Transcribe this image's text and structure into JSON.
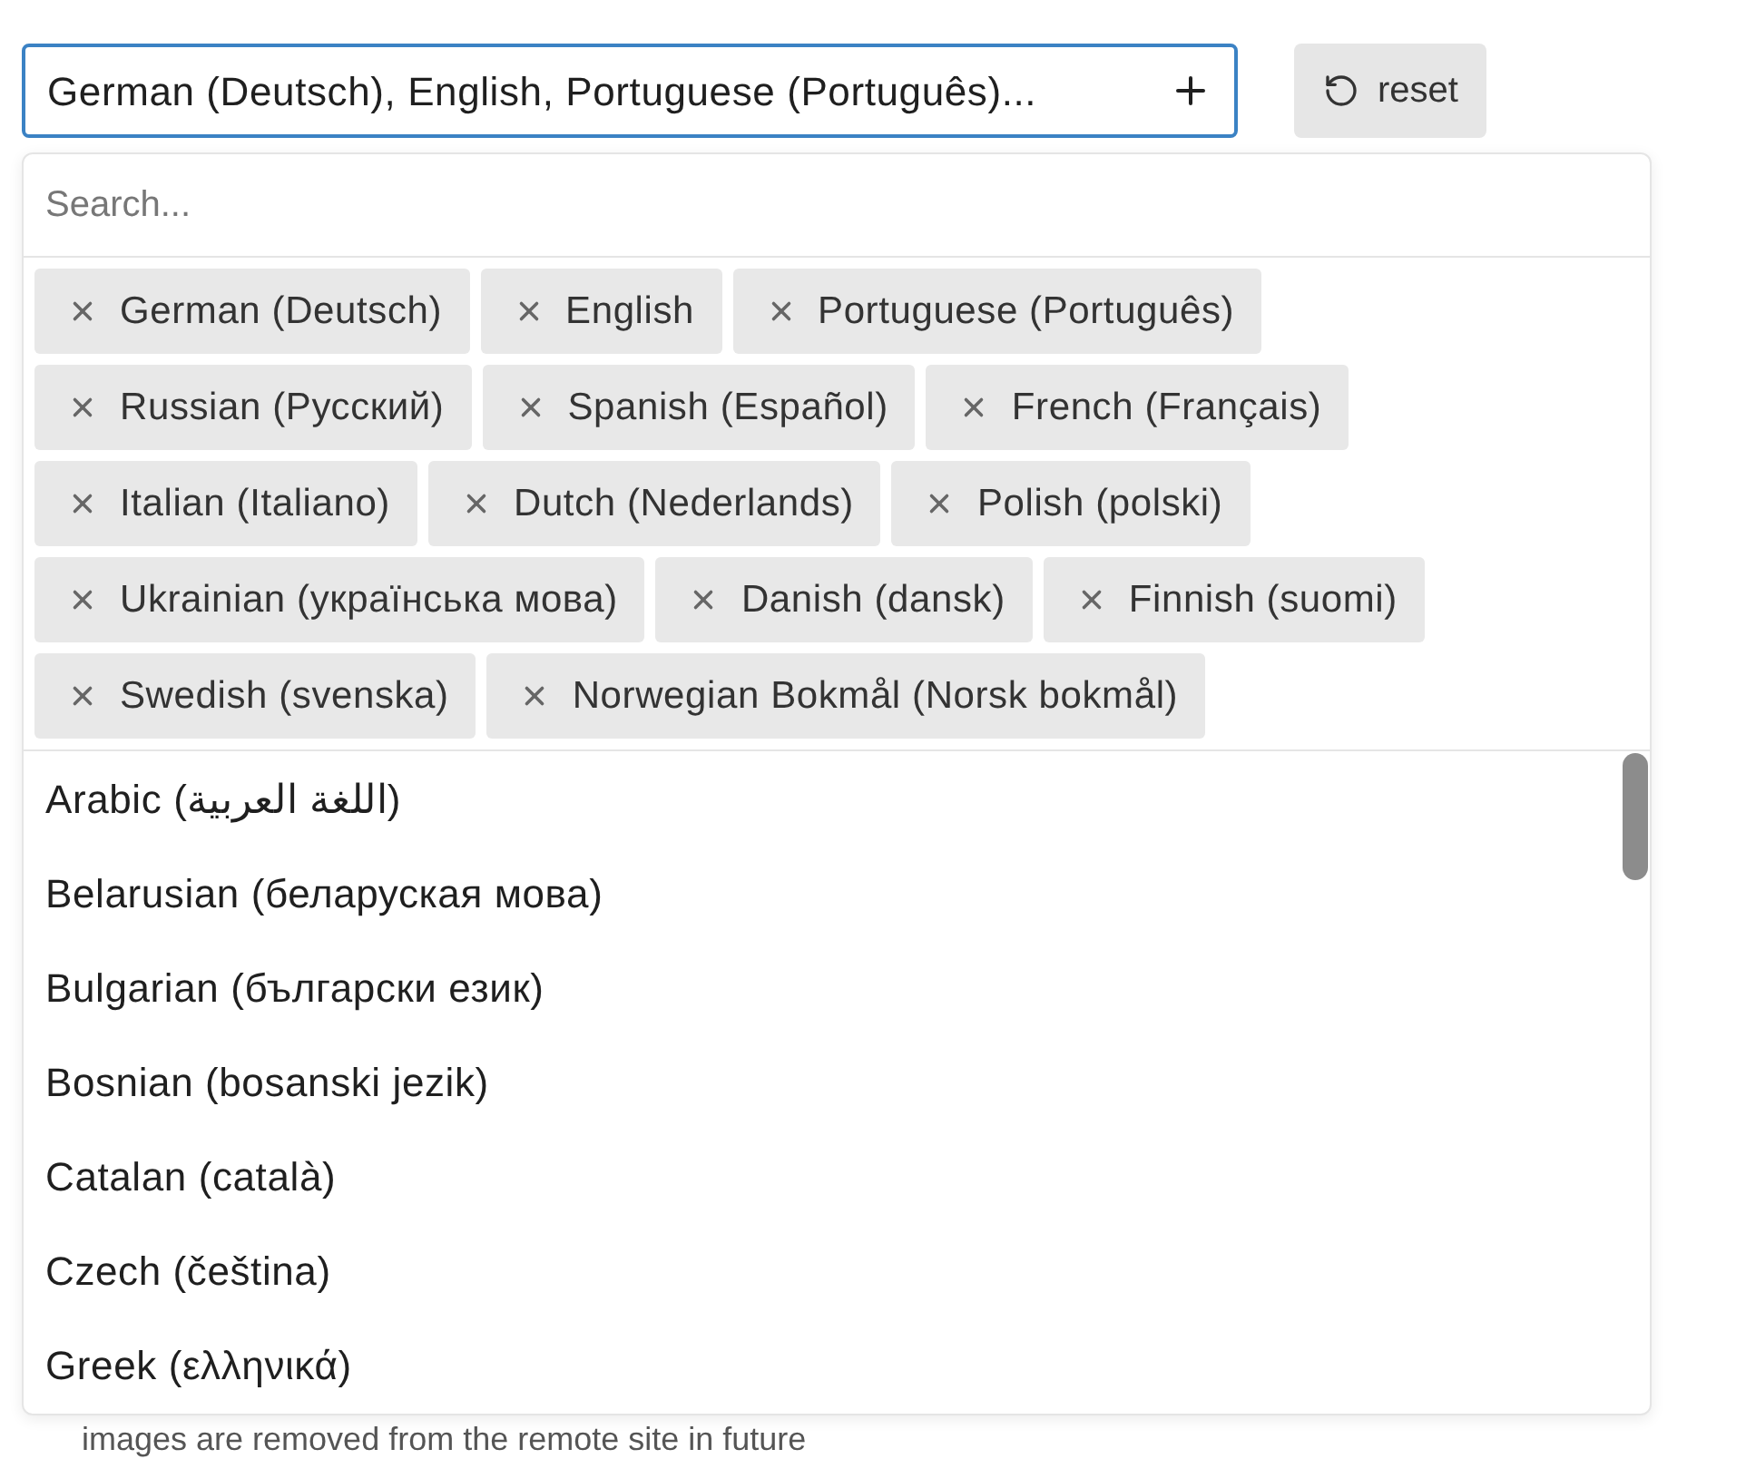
{
  "select": {
    "value": "German (Deutsch), English, Portuguese (Português)..."
  },
  "reset_button": {
    "label": "reset"
  },
  "dropdown": {
    "search": {
      "placeholder": "Search..."
    },
    "selected_chips": [
      {
        "label": "German (Deutsch)"
      },
      {
        "label": "English"
      },
      {
        "label": "Portuguese (Português)"
      },
      {
        "label": "Russian (Русский)"
      },
      {
        "label": "Spanish (Español)"
      },
      {
        "label": "French (Français)"
      },
      {
        "label": "Italian (Italiano)"
      },
      {
        "label": "Dutch (Nederlands)"
      },
      {
        "label": "Polish (polski)"
      },
      {
        "label": "Ukrainian (українська мова)"
      },
      {
        "label": "Danish (dansk)"
      },
      {
        "label": "Finnish (suomi)"
      },
      {
        "label": "Swedish (svenska)"
      },
      {
        "label": "Norwegian Bokmål (Norsk bokmål)"
      }
    ],
    "options": [
      "Arabic (اللغة العربية)",
      "Belarusian (беларуская мова)",
      "Bulgarian (български език)",
      "Bosnian (bosanski jezik)",
      "Catalan (català)",
      "Czech (čeština)",
      "Greek (ελληνικά)"
    ]
  },
  "background_text": "images are removed from the remote site in future"
}
